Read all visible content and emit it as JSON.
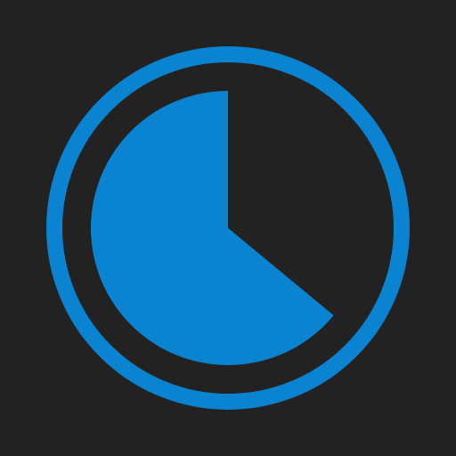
{
  "icon": {
    "name": "timer-icon",
    "background_color": "#222222",
    "accent_color": "#0a84d0",
    "elapsed_fraction": 0.64
  }
}
